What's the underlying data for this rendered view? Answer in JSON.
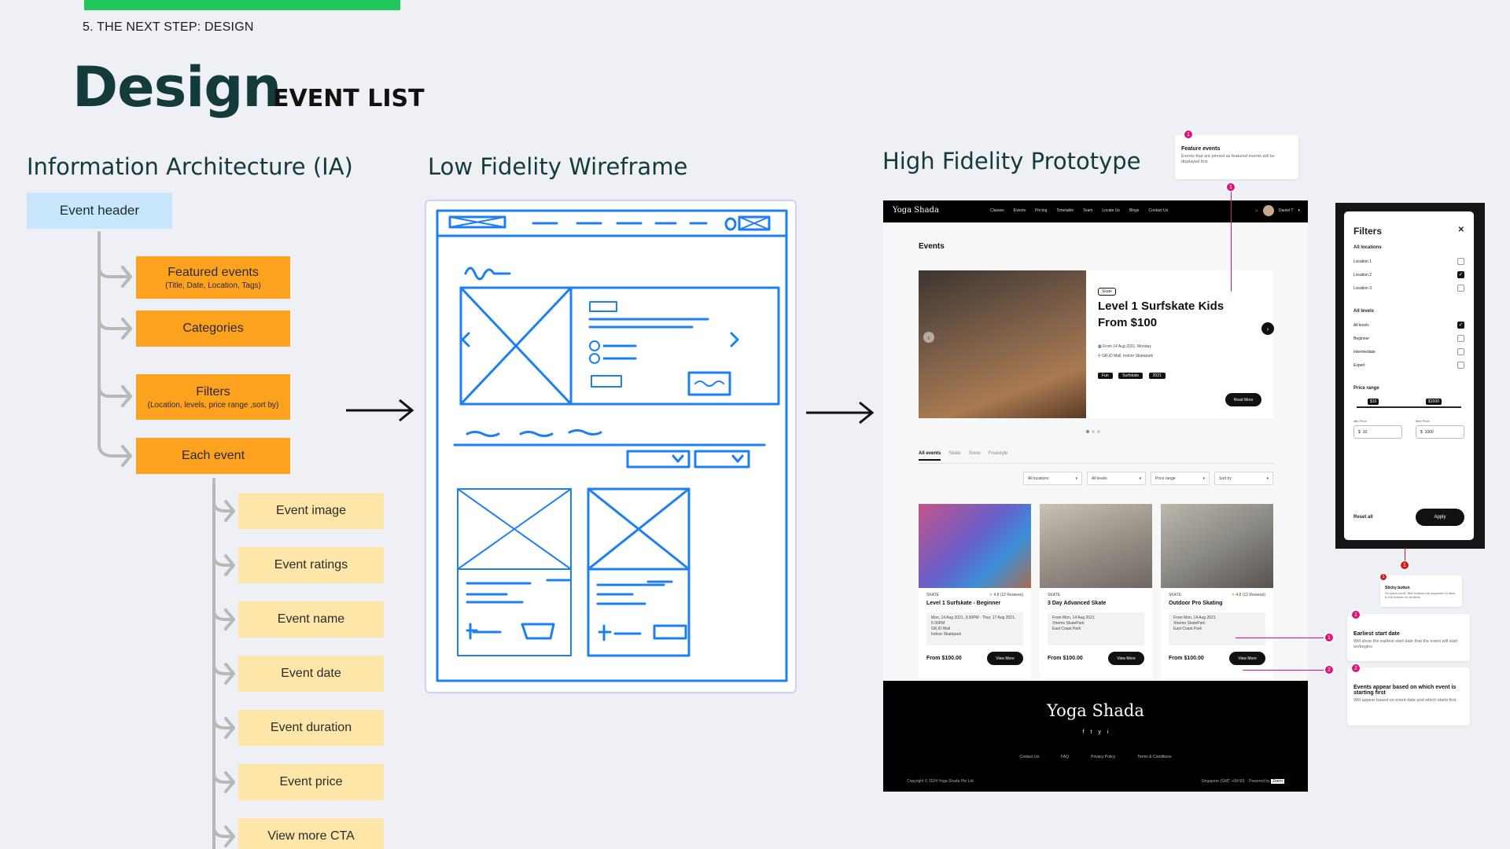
{
  "header": {
    "section_label": "5. THE NEXT STEP: DESIGN",
    "title": "Design",
    "subtitle": "EVENT LIST"
  },
  "columns": {
    "ia": "Information Architecture (IA)",
    "wireframe": "Low Fidelity Wireframe",
    "prototype": "High Fidelity Prototype"
  },
  "ia": {
    "root": "Event header",
    "level1": [
      {
        "label": "Featured events",
        "sub": "(Title, Date, Location, Tags)"
      },
      {
        "label": "Categories",
        "sub": ""
      },
      {
        "label": "Filters",
        "sub": "(Location, levels, price range ,sort by)"
      },
      {
        "label": "Each event",
        "sub": ""
      }
    ],
    "level2": [
      "Event image",
      "Event ratings",
      "Event name",
      "Event date",
      "Event duration",
      "Event price",
      "View more CTA"
    ]
  },
  "prototype": {
    "logo": "Yoga Shada",
    "nav": [
      "Classes",
      "Events",
      "Pricing",
      "Timetable",
      "Team",
      "Locate Us",
      "Blogs",
      "Contact Us"
    ],
    "user": "Daniel T",
    "events_heading": "Events",
    "featured": {
      "tag": "Skate",
      "title_line1": "Level 1 Surfskate Kids",
      "title_line2": "From $100",
      "date": "From 14 Aug 2021, Monday",
      "location": "GR.iD Mall, Indoor Skatepark",
      "tags": [
        "Fun",
        "Surfskate",
        "2021"
      ],
      "cta": "Read More"
    },
    "tabs": [
      "All events",
      "Skate",
      "Snow",
      "Freestyle"
    ],
    "selects": [
      "All locations",
      "All levels",
      "Price range",
      "Sort by"
    ],
    "cards": [
      {
        "category": "SKATE",
        "rating": "4.8",
        "reviews": "(12 Reviews)",
        "name": "Level 1 Surfskate - Beginner",
        "date": "Mon, 14 Aug 2021, 3:30PM - Thur, 17 Aug 2021, 5:30PM",
        "loc": "GR.iD Mall",
        "loc2": "Indoor Skatepark",
        "price": "From $100.00",
        "cta": "View More"
      },
      {
        "category": "SKATE",
        "rating": "",
        "reviews": "",
        "name": "3 Day Advanced Skate",
        "date": "From Mon, 14 Aug 2021",
        "loc": "Xtreme SkatePark",
        "loc2": "East Coast Park",
        "price": "From $100.00",
        "cta": "View More"
      },
      {
        "category": "SKATE",
        "rating": "4.8",
        "reviews": "(12 Reviews)",
        "name": "Outdoor Pro Skating",
        "date": "From Mon, 14 Aug 2021",
        "loc": "Xtreme SkatePark",
        "loc2": "East Coast Park",
        "price": "From $100.00",
        "cta": "View More"
      }
    ],
    "footer": {
      "logo": "Yoga Shada",
      "social": [
        "f",
        "t",
        "y",
        "i"
      ],
      "links": [
        "Contact Us",
        "FAQ",
        "Privacy Policy",
        "Terms & Conditions"
      ],
      "copyright": "Copyright © 2024 Yoga Shada Pte Ltd",
      "region": "Singapore (GMT +08:00)",
      "powered": "Powered by",
      "powered_brand": "Zeero"
    }
  },
  "filters": {
    "title": "Filters",
    "close": "✕",
    "locations_label": "All locations",
    "locations": [
      {
        "label": "Location 1",
        "checked": false
      },
      {
        "label": "Location 2",
        "checked": true
      },
      {
        "label": "Location 3",
        "checked": false
      }
    ],
    "levels_label": "All levels",
    "levels": [
      {
        "label": "All levels",
        "checked": true
      },
      {
        "label": "Beginner",
        "checked": false
      },
      {
        "label": "Intermediate",
        "checked": false
      },
      {
        "label": "Expert",
        "checked": false
      }
    ],
    "price_label": "Price range",
    "price_min_pill": "$10",
    "price_max_pill": "$1000",
    "min_label": "Min Price",
    "max_label": "Max Price",
    "min_value": "10",
    "max_value": "1000",
    "currency": "$",
    "reset": "Reset all",
    "apply": "Apply"
  },
  "annotations": {
    "feature": {
      "num": "1",
      "title": "Feature events",
      "text": "Events that are pinned as featured events will be displayed first"
    },
    "sticky": {
      "num": "1",
      "title": "Sticky button",
      "text": "So users scroll, filter buttons are supposed to stick to the bottom for all filters"
    },
    "earliest": {
      "num": "1",
      "title": "Earliest start date",
      "text": "Will show the earliest start date that the event will start on/begins"
    },
    "appear": {
      "num": "2",
      "title": "Events appear based on which event is starting first",
      "text": "Will appear based on event date and which starts first"
    }
  },
  "colors": {
    "accent_green": "#1ec85a",
    "orange": "#fca21f",
    "yellow": "#fde6a7",
    "blue_header": "#c7e6fb",
    "wire_blue": "#1e7ff5",
    "annotation_pink": "#e0107b"
  }
}
